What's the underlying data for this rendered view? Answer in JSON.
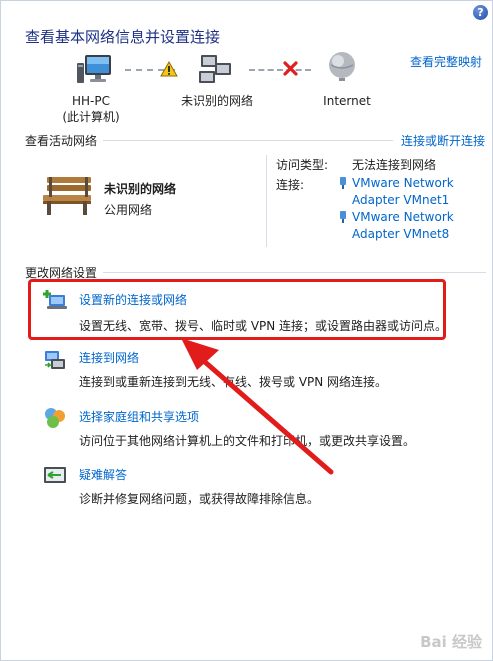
{
  "page": {
    "title": "查看基本网络信息并设置连接",
    "full_map_link": "查看完整映射",
    "help_glyph": "?"
  },
  "map": {
    "nodes": [
      {
        "label": "HH-PC",
        "sublabel": "(此计算机)",
        "icon": "computer-icon"
      },
      {
        "label": "未识别的网络",
        "icon": "network-icon"
      },
      {
        "label": "Internet",
        "icon": "globe-icon"
      }
    ],
    "links": [
      {
        "status": "warning",
        "icon": "warning-icon"
      },
      {
        "status": "disconnected",
        "icon": "red-x-icon"
      }
    ]
  },
  "active_networks": {
    "heading": "查看活动网络",
    "connect_link": "连接或断开连接",
    "network_name": "未识别的网络",
    "network_type": "公用网络",
    "access_type_label": "访问类型:",
    "access_type_value": "无法连接到网络",
    "connections_label": "连接:",
    "adapters": [
      {
        "line1": "VMware Network",
        "line2": "Adapter VMnet1"
      },
      {
        "line1": "VMware Network",
        "line2": "Adapter VMnet8"
      }
    ]
  },
  "settings": {
    "heading": "更改网络设置",
    "tasks": [
      {
        "title": "设置新的连接或网络",
        "desc": "设置无线、宽带、拨号、临时或 VPN 连接；或设置路由器或访问点。",
        "icon": "new-connection-icon"
      },
      {
        "title": "连接到网络",
        "desc": "连接到或重新连接到无线、有线、拨号或 VPN 网络连接。",
        "icon": "connect-network-icon"
      },
      {
        "title": "选择家庭组和共享选项",
        "desc": "访问位于其他网络计算机上的文件和打印机，或更改共享设置。",
        "icon": "homegroup-icon"
      },
      {
        "title": "疑难解答",
        "desc": "诊断并修复网络问题，或获得故障排除信息。",
        "icon": "troubleshoot-icon"
      }
    ]
  },
  "annotation": {
    "color": "#e21b1b"
  },
  "watermark": "Bai 经验"
}
